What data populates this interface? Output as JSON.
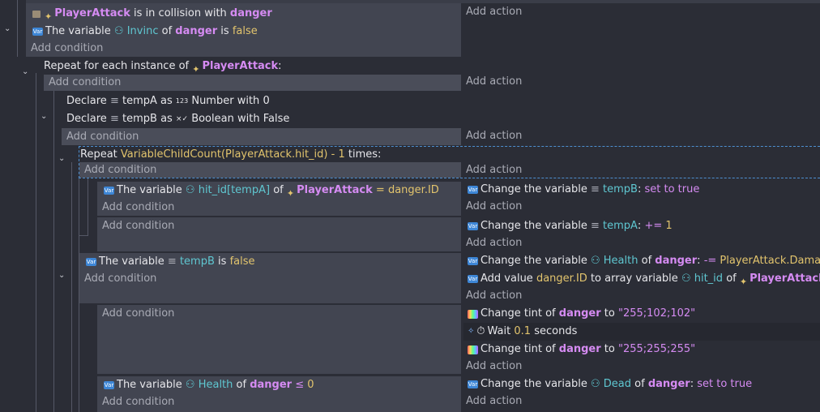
{
  "common": {
    "add_condition": "Add condition",
    "add_action": "Add action"
  },
  "row1": {
    "c1": {
      "object": "PlayerAttack",
      "text": "is in collision with",
      "target": "danger"
    },
    "c2": {
      "prefix": "The variable",
      "variable": "Invinc",
      "of": "of",
      "object": "danger",
      "is": "is",
      "value": "false"
    }
  },
  "row2": {
    "text": "Repeat for each instance of",
    "object": "PlayerAttack",
    "suffix": ":"
  },
  "row3": {
    "d1": {
      "declare": "Declare",
      "name": "tempA",
      "as": "as",
      "type_icon": "123",
      "type": "Number",
      "with": "with",
      "value": "0"
    },
    "d2": {
      "declare": "Declare",
      "name": "tempB",
      "as": "as",
      "type_icon": "×✓",
      "type": "Boolean",
      "with": "with",
      "value": "False"
    }
  },
  "row4": {
    "repeat": "Repeat",
    "expr": "VariableChildCount(PlayerAttack.hit_id) - 1",
    "times": "times:"
  },
  "row5": {
    "cond": {
      "prefix": "The variable",
      "variable": "hit_id[tempA]",
      "of": "of",
      "object": "PlayerAttack",
      "op": "=",
      "value": "danger.ID"
    },
    "act": {
      "prefix": "Change the variable",
      "variable": "tempB",
      "op": ":",
      "value": "set to true"
    }
  },
  "row6": {
    "act": {
      "prefix": "Change the variable",
      "variable": "tempA",
      "op": ":",
      "opval": "+=",
      "value": "1"
    }
  },
  "row7": {
    "cond": {
      "prefix": "The variable",
      "variable": "tempB",
      "is": "is",
      "value": "false"
    },
    "a1": {
      "prefix": "Change the variable",
      "variable": "Health",
      "of": "of",
      "object": "danger",
      "op": ":",
      "opval": "-=",
      "value": "PlayerAttack.Damage"
    },
    "a2": {
      "prefix": "Add value",
      "value": "danger.ID",
      "to": "to array variable",
      "variable": "hit_id",
      "of": "of",
      "object": "PlayerAttack"
    }
  },
  "row8": {
    "a1": {
      "prefix": "Change tint of",
      "object": "danger",
      "to": "to",
      "value": "\"255;102;102\""
    },
    "a2": {
      "prefix": "Wait",
      "value": "0.1",
      "unit": "seconds"
    },
    "a3": {
      "prefix": "Change tint of",
      "object": "danger",
      "to": "to",
      "value": "\"255;255;255\""
    }
  },
  "row9": {
    "cond": {
      "prefix": "The variable",
      "variable": "Health",
      "of": "of",
      "object": "danger",
      "op": "≤",
      "value": "0"
    },
    "act": {
      "prefix": "Change the variable",
      "variable": "Dead",
      "of": "of",
      "object": "danger",
      "op": ":",
      "value": "set to true"
    }
  }
}
